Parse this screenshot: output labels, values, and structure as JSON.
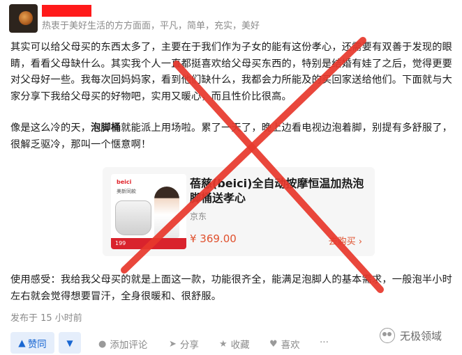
{
  "author": {
    "bio": "热衷于美好生活的方方面面，平凡，简单，充实，美好"
  },
  "article": {
    "p1": "其实可以给父母买的东西太多了，主要在于我们作为子女的能有这份孝心，还需要有双善于发现的眼睛，看看父母缺什么。其实我个人一直都挺喜欢给父母买东西的，特别是结婚有娃了之后，觉得更要对父母好一些。我每次回妈妈家，看到他们缺什么，我都会力所能及的买回家送给他们。下面就与大家分享下我给父母买的好物吧，实用又暖心，而且性价比很高。",
    "p2_before": "像是这么冷的天，",
    "p2_bold": "泡脚桶",
    "p2_after": "就能派上用场啦。累了一天了，晚上边看电视边泡着脚，别提有多舒服了，很解乏驱冷，那叫一个惬意啊！",
    "p3": "使用感受：我给我父母买的就是上面这一款，功能很齐全，能满足泡脚人的基本需求，一般泡半小时左右就会觉得想要冒汗，全身很暖和、很舒服。"
  },
  "product": {
    "image_brand": "beici",
    "image_tag": "美新同款",
    "image_price": "199",
    "title": "蓓慈(beici)全自动按摩恒温加热泡脚桶送孝心",
    "shop": "京东",
    "price": "¥ 369.00",
    "buy_label": "去购买",
    "buy_chevron": "›"
  },
  "meta": {
    "posted": "发布于 15 小时前"
  },
  "actions": {
    "upvote": "赞同",
    "comment": "添加评论",
    "share": "分享",
    "favorite": "收藏",
    "like": "喜欢",
    "more": "···"
  },
  "watermark": {
    "text": "无极领域"
  },
  "colors": {
    "accent": "#1967d2",
    "price": "#e0502d",
    "cross": "#e8382c",
    "redaction": "#ff1a1a"
  },
  "icons": {
    "upvote": "triangle-up-icon",
    "downvote": "triangle-down-icon",
    "comment": "speech-bubble-icon",
    "share": "paper-plane-icon",
    "favorite": "star-icon",
    "like": "heart-icon"
  }
}
